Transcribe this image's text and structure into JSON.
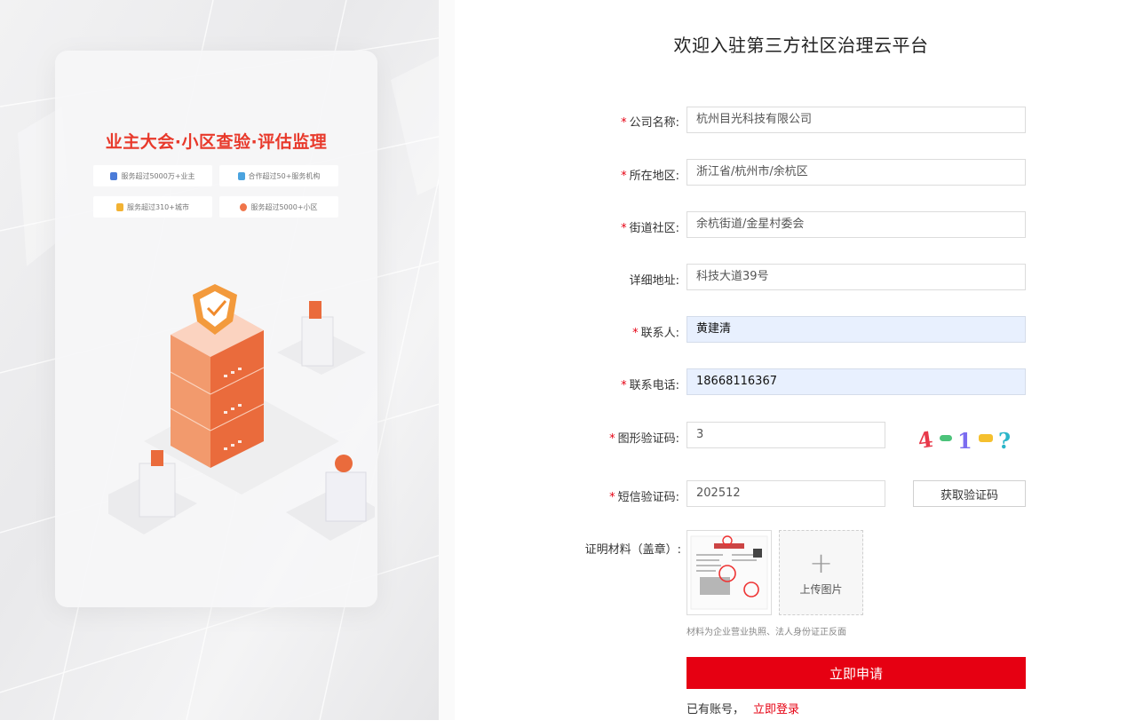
{
  "hero": {
    "slogan": "业主大会·小区查验·评估监理",
    "stats": [
      {
        "icon": "user-icon",
        "color": "#4a7bd8",
        "text": "服务超过5000万+业主"
      },
      {
        "icon": "building-icon",
        "color": "#4aa3df",
        "text": "合作超过50+服务机构"
      },
      {
        "icon": "city-icon",
        "color": "#f2b233",
        "text": "服务超过310+城市"
      },
      {
        "icon": "community-icon",
        "color": "#f0754a",
        "text": "服务超过5000+小区"
      }
    ]
  },
  "form": {
    "title": "欢迎入驻第三方社区治理云平台",
    "required_mark": "*",
    "fields": {
      "company": {
        "label": "公司名称:",
        "value": "杭州目光科技有限公司"
      },
      "region": {
        "label": "所在地区:",
        "value": "浙江省/杭州市/余杭区"
      },
      "street": {
        "label": "街道社区:",
        "value": "余杭街道/金星村委会"
      },
      "address": {
        "label": "详细地址:",
        "value": "科技大道39号"
      },
      "contact": {
        "label": "联系人:",
        "value": "黄建清"
      },
      "phone": {
        "label": "联系电话:",
        "value": "18668116367"
      },
      "captcha": {
        "label": "图形验证码:",
        "value": "3"
      },
      "sms": {
        "label": "短信验证码:",
        "value": "202512"
      }
    },
    "sms_button": "获取验证码",
    "material_label": "证明材料（盖章）:",
    "upload_label": "上传图片",
    "upload_hint": "材料为企业营业执照、法人身份证正反面",
    "submit_label": "立即申请",
    "have_account": "已有账号，",
    "login_link": "立即登录",
    "accent_color": "#e60012",
    "autofill_color": "#e8f0fe"
  }
}
